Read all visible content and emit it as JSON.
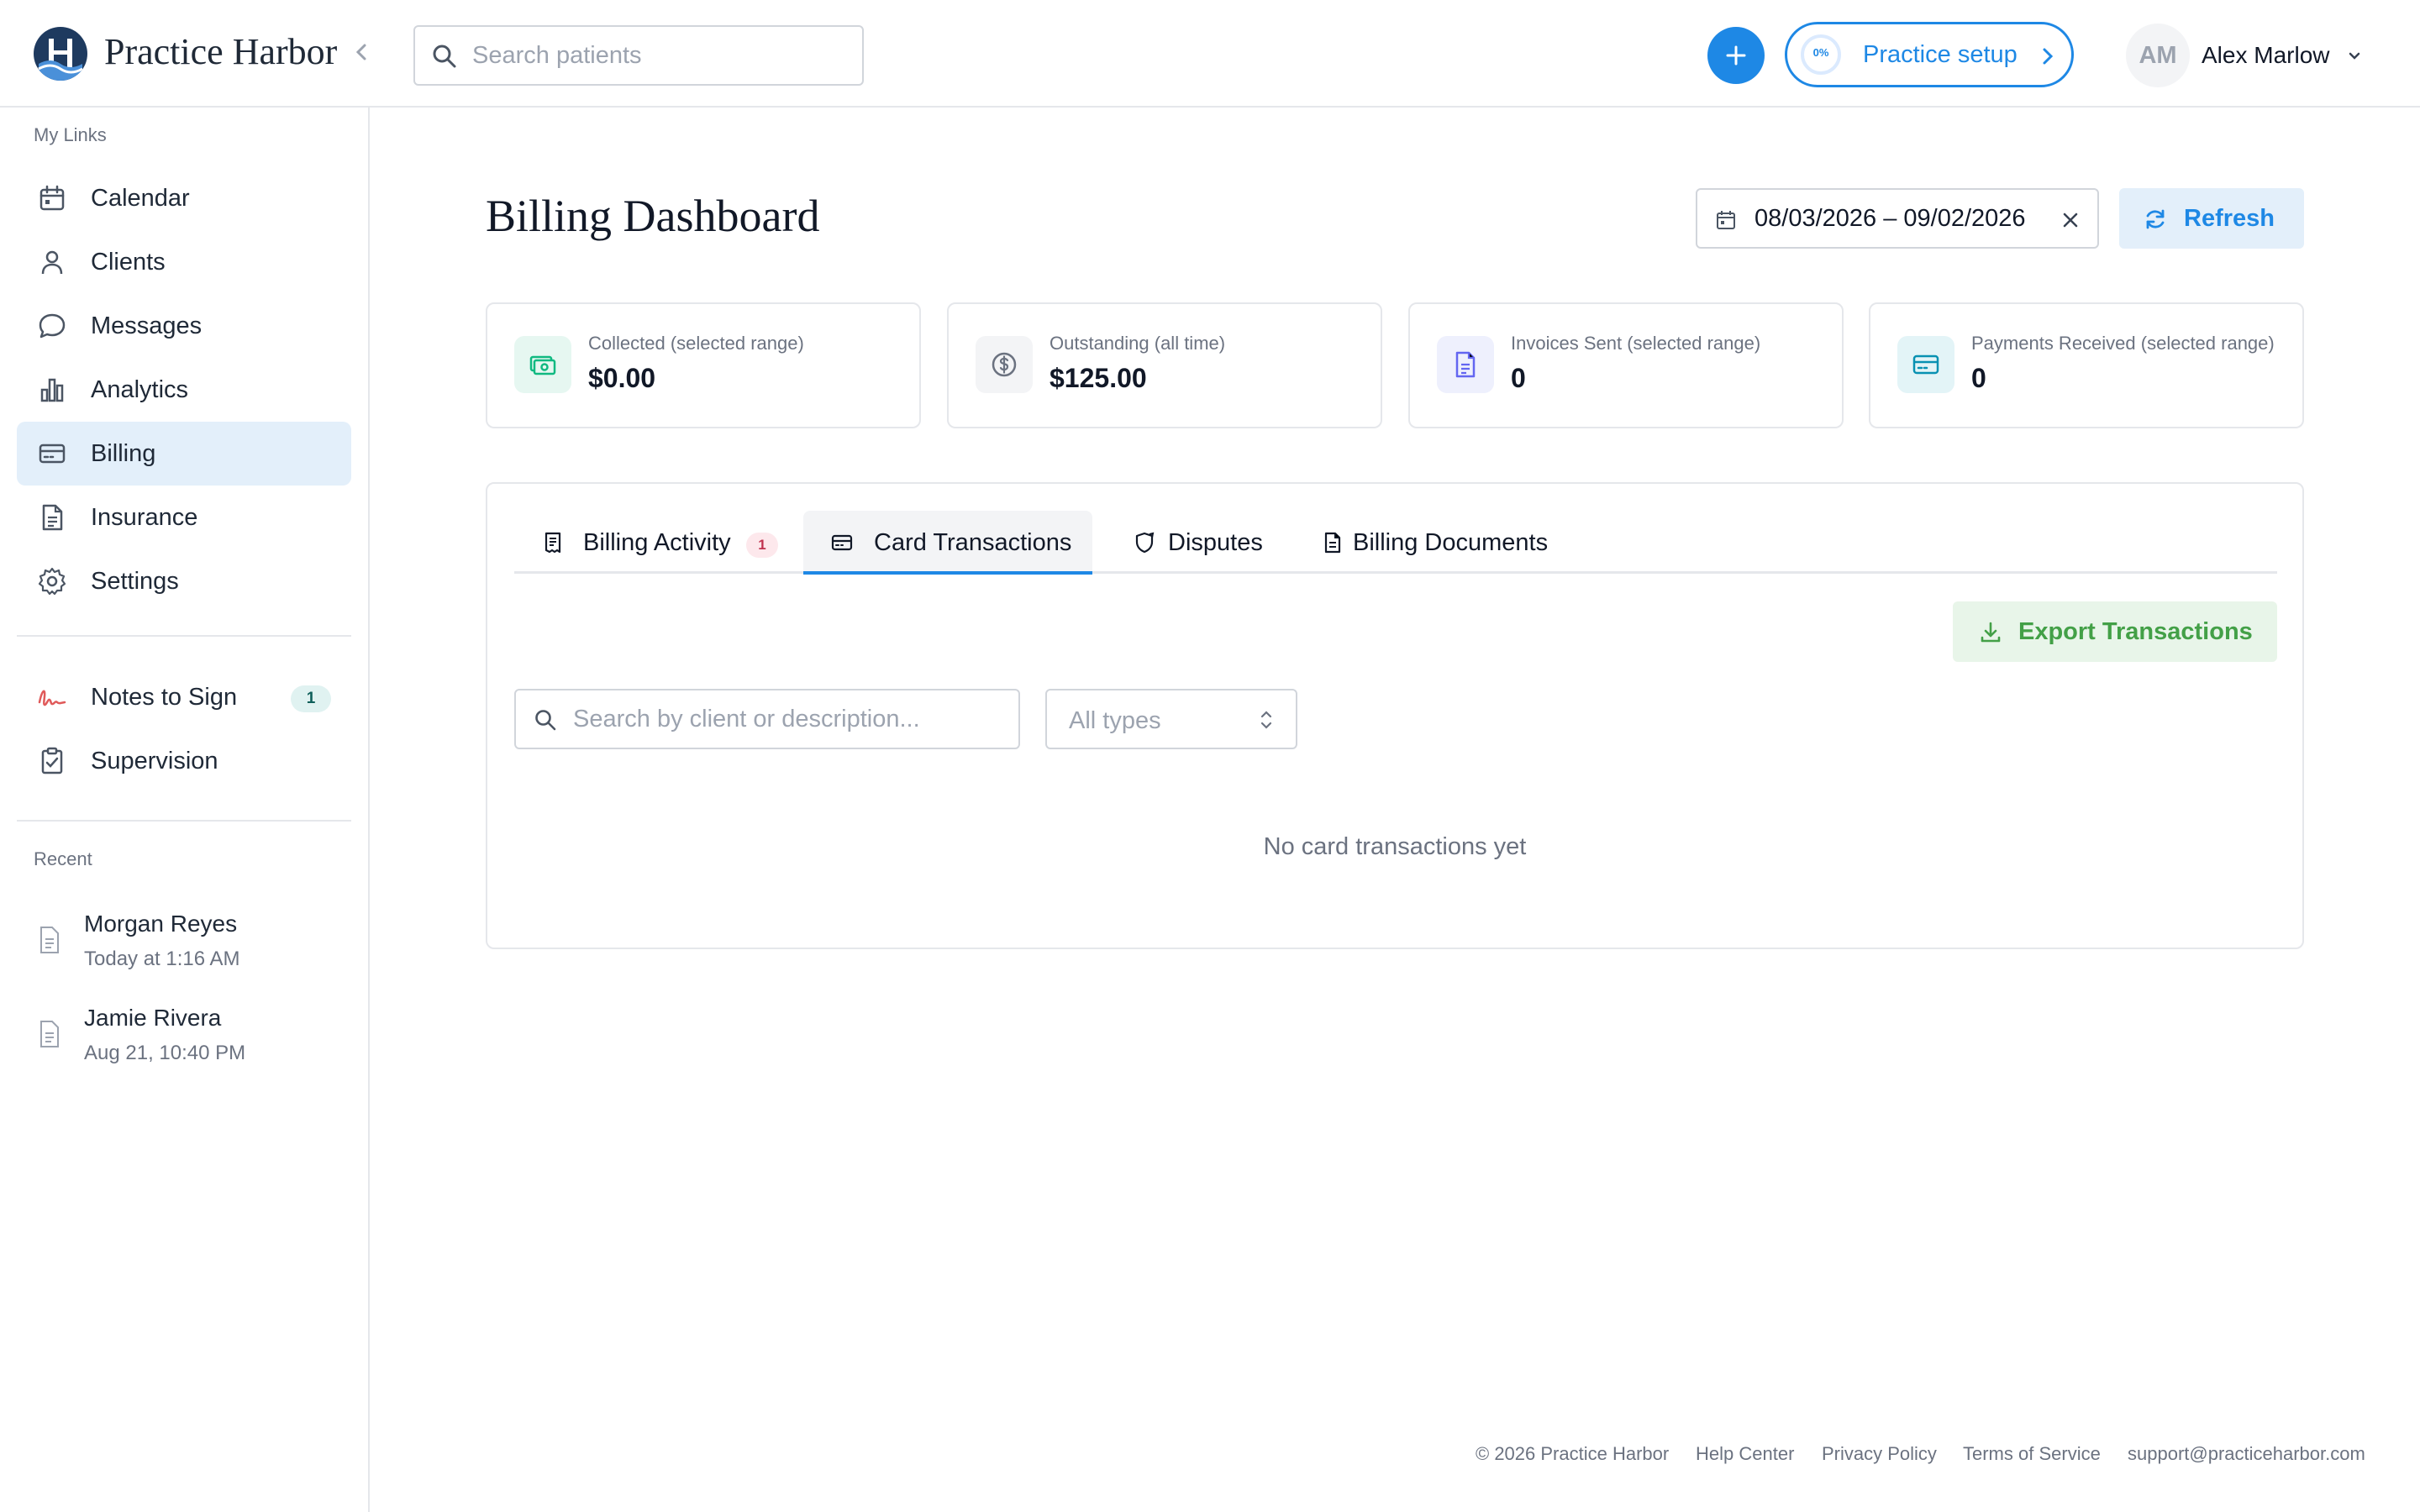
{
  "app": {
    "name": "Practice Harbor"
  },
  "header": {
    "search_placeholder": "Search patients",
    "setup_progress": "0%",
    "setup_label": "Practice setup",
    "user_initials": "AM",
    "user_name": "Alex Marlow"
  },
  "sidebar": {
    "my_links_label": "My Links",
    "items": [
      {
        "label": "Calendar",
        "icon": "calendar-icon"
      },
      {
        "label": "Clients",
        "icon": "user-icon"
      },
      {
        "label": "Messages",
        "icon": "message-icon"
      },
      {
        "label": "Analytics",
        "icon": "bar-chart-icon"
      },
      {
        "label": "Billing",
        "icon": "credit-card-icon",
        "active": true
      },
      {
        "label": "Insurance",
        "icon": "document-icon"
      },
      {
        "label": "Settings",
        "icon": "gear-icon"
      }
    ],
    "notes_label": "Notes to Sign",
    "notes_count": "1",
    "supervision_label": "Supervision",
    "recent_label": "Recent",
    "recent": [
      {
        "name": "Morgan Reyes",
        "time": "Today at 1:16 AM"
      },
      {
        "name": "Jamie Rivera",
        "time": "Aug 21, 10:40 PM"
      }
    ]
  },
  "main": {
    "title": "Billing Dashboard",
    "date_range": "08/03/2026 – 09/02/2026",
    "refresh_label": "Refresh",
    "stats": [
      {
        "label": "Collected (selected range)",
        "value": "$0.00",
        "icon": "cash-icon",
        "color": "#10b981"
      },
      {
        "label": "Outstanding (all time)",
        "value": "$125.00",
        "icon": "dollar-circle-icon",
        "color": "#6b7280"
      },
      {
        "label": "Invoices Sent (selected range)",
        "value": "0",
        "icon": "invoice-icon",
        "color": "#6366f1"
      },
      {
        "label": "Payments Received (selected range)",
        "value": "0",
        "icon": "card-icon",
        "color": "#0891b2"
      }
    ],
    "tabs": [
      {
        "label": "Billing Activity",
        "badge": "1"
      },
      {
        "label": "Card Transactions",
        "active": true
      },
      {
        "label": "Disputes"
      },
      {
        "label": "Billing Documents"
      }
    ],
    "export_label": "Export Transactions",
    "search_placeholder": "Search by client or description...",
    "type_select": "All types",
    "empty_message": "No card transactions yet"
  },
  "footer": {
    "copyright": "© 2026 Practice Harbor",
    "links": [
      "Help Center",
      "Privacy Policy",
      "Terms of Service",
      "support@practiceharbor.com"
    ]
  },
  "colors": {
    "accent": "#1e88e5",
    "success": "#43a047",
    "active_bg": "#e3effa"
  }
}
